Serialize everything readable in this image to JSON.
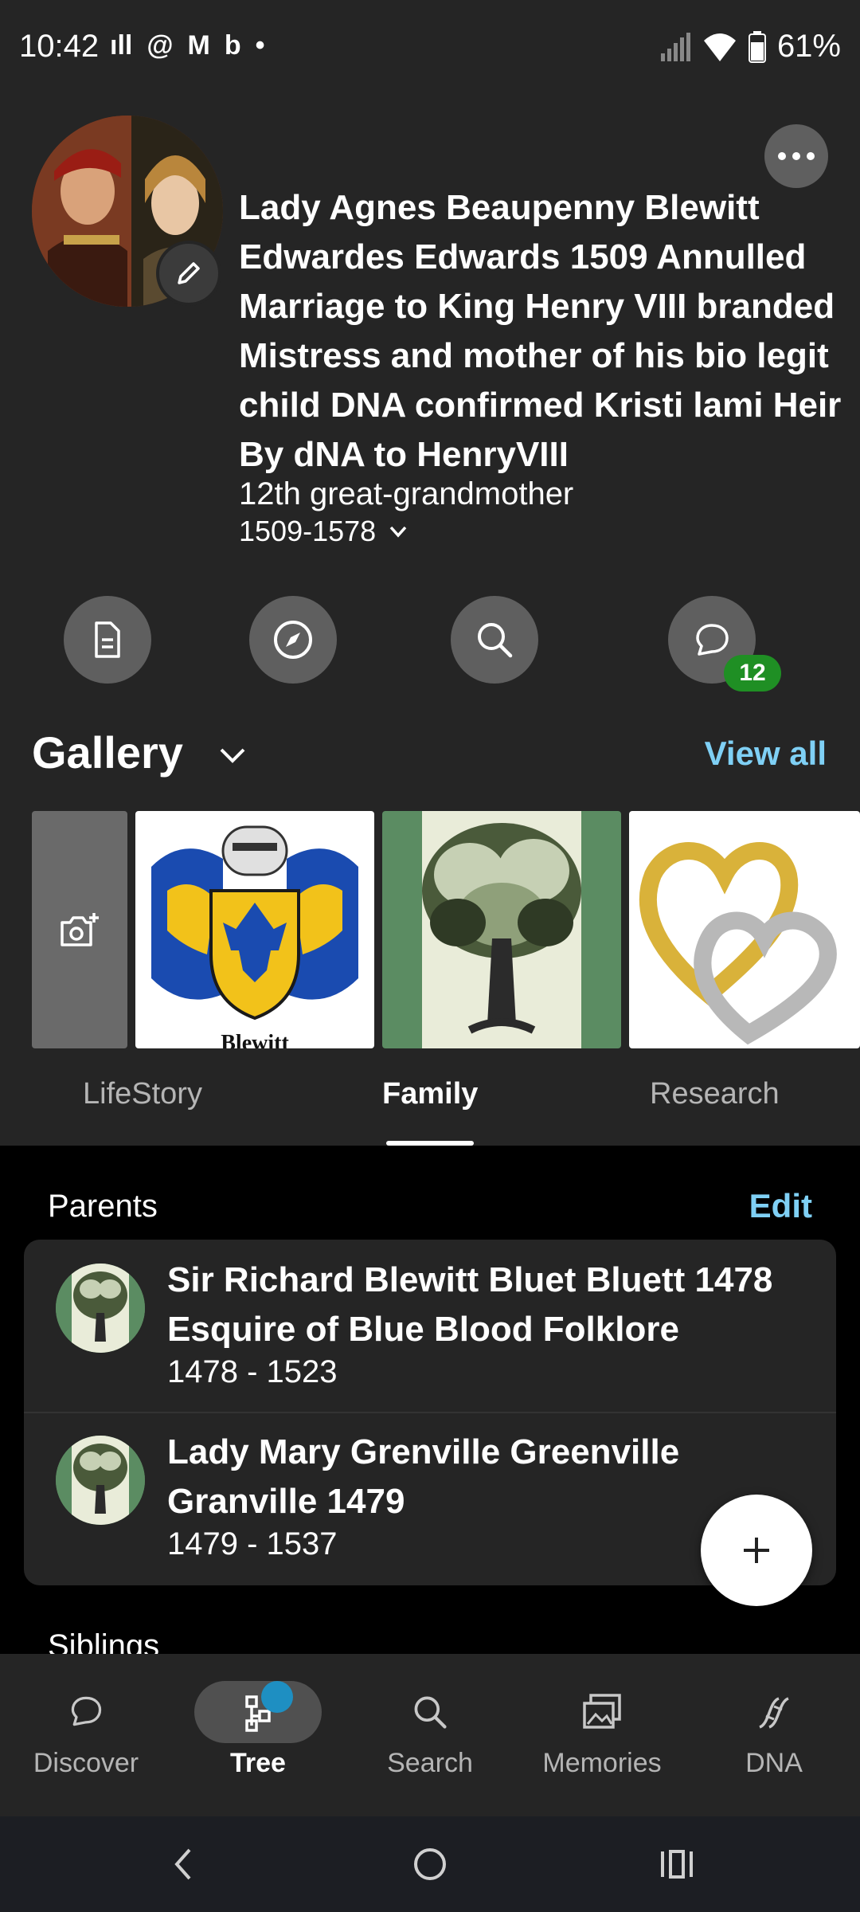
{
  "status_bar": {
    "time": "10:42",
    "battery": "61%",
    "notification_icons": [
      "signal-bars-icon",
      "threads-icon",
      "gmail-icon",
      "bing-icon",
      "dot-icon"
    ]
  },
  "profile": {
    "name": "Lady Agnes Beaupenny Blewitt Edwardes Edwards 1509 Annulled Marriage to King Henry VIII branded Mistress and mother of his bio legit child DNA confirmed Kristi lami Heir By dNA to HenryVIII",
    "relationship": "12th great-grandmother",
    "dates": "1509-1578"
  },
  "actions": {
    "comments_count": "12"
  },
  "gallery": {
    "title": "Gallery",
    "view_all": "View all",
    "crest_caption": "Blewitt"
  },
  "tabs": [
    {
      "label": "LifeStory"
    },
    {
      "label": "Family"
    },
    {
      "label": "Research"
    }
  ],
  "parents": {
    "label": "Parents",
    "edit": "Edit",
    "items": [
      {
        "name": "Sir Richard  Blewitt Bluet Bluett 1478 Esquire of Blue Blood Folklore",
        "dates": "1478 - 1523"
      },
      {
        "name": "Lady Mary Grenville Greenville Granville 1479",
        "dates": "1479 - 1537"
      }
    ]
  },
  "siblings": {
    "label": "Siblings"
  },
  "bottom_nav": [
    {
      "label": "Discover",
      "icon": "chat-bubble-icon"
    },
    {
      "label": "Tree",
      "icon": "tree-icon"
    },
    {
      "label": "Search",
      "icon": "search-icon"
    },
    {
      "label": "Memories",
      "icon": "images-icon"
    },
    {
      "label": "DNA",
      "icon": "dna-icon"
    }
  ],
  "colors": {
    "accent": "#7fd0f5",
    "badge": "#1f8f24",
    "surface": "#252525",
    "background": "#000000"
  }
}
